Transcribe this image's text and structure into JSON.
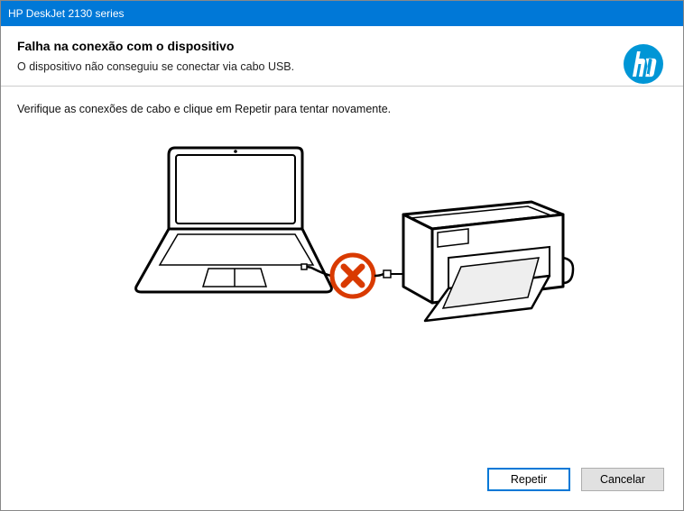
{
  "titlebar": {
    "title": "HP DeskJet 2130 series"
  },
  "header": {
    "heading": "Falha na conexão com o dispositivo",
    "subheading": "O dispositivo não conseguiu se conectar via cabo USB."
  },
  "content": {
    "instruction": "Verifique as conexões de cabo e clique em Repetir para tentar novamente."
  },
  "buttons": {
    "retry": "Repetir",
    "cancel": "Cancelar"
  }
}
